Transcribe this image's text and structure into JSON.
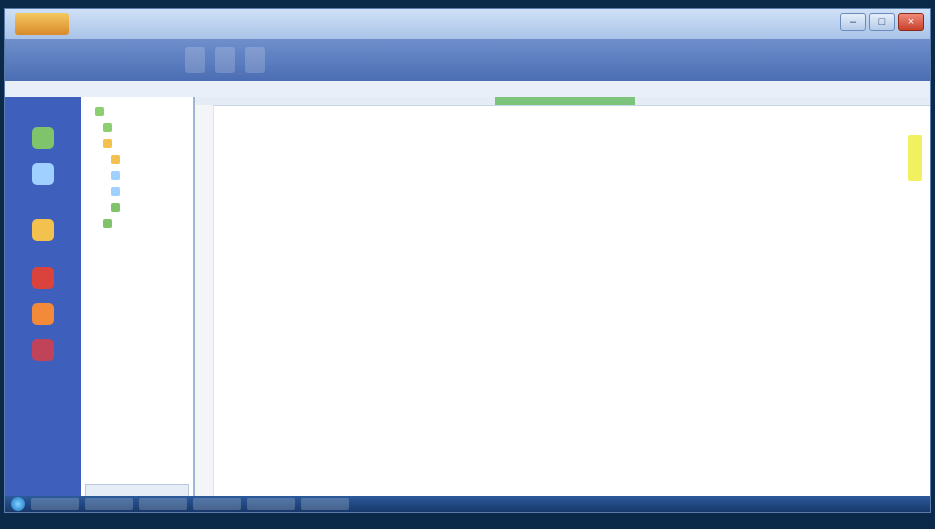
{
  "window": {
    "title": "",
    "logo_label": ""
  },
  "controls": {
    "minimize": "–",
    "maximize": "□",
    "close": "×"
  },
  "ribbon": {
    "buttons": [
      "",
      "",
      ""
    ]
  },
  "menubar": {
    "items": [
      "",
      "",
      "",
      "",
      ""
    ]
  },
  "left_rail": {
    "icons": [
      {
        "name": "home-icon",
        "color": "#7fc36a"
      },
      {
        "name": "document-icon",
        "color": "#9fd0ff"
      },
      {
        "name": "folder-icon",
        "color": "#f2c14e"
      },
      {
        "name": "alert-icon",
        "color": "#d9433c"
      },
      {
        "name": "settings-icon",
        "color": "#f28a3a"
      },
      {
        "name": "chart-icon",
        "color": "#c0435a"
      }
    ]
  },
  "tree": {
    "items": [
      "",
      "",
      "",
      "",
      "",
      "",
      "",
      ""
    ],
    "footer": ""
  },
  "document": {
    "heading": "",
    "columns": [
      "",
      "",
      "",
      "",
      "",
      "",
      "",
      "",
      "",
      "",
      "",
      ""
    ]
  },
  "taskbar": {
    "items": [
      "",
      "",
      "",
      "",
      "",
      ""
    ]
  },
  "colors": {
    "accent": "#4b6db3",
    "rail": "#3f5fbd",
    "active_tab": "#7cc47c",
    "highlight": "#f0f060"
  }
}
